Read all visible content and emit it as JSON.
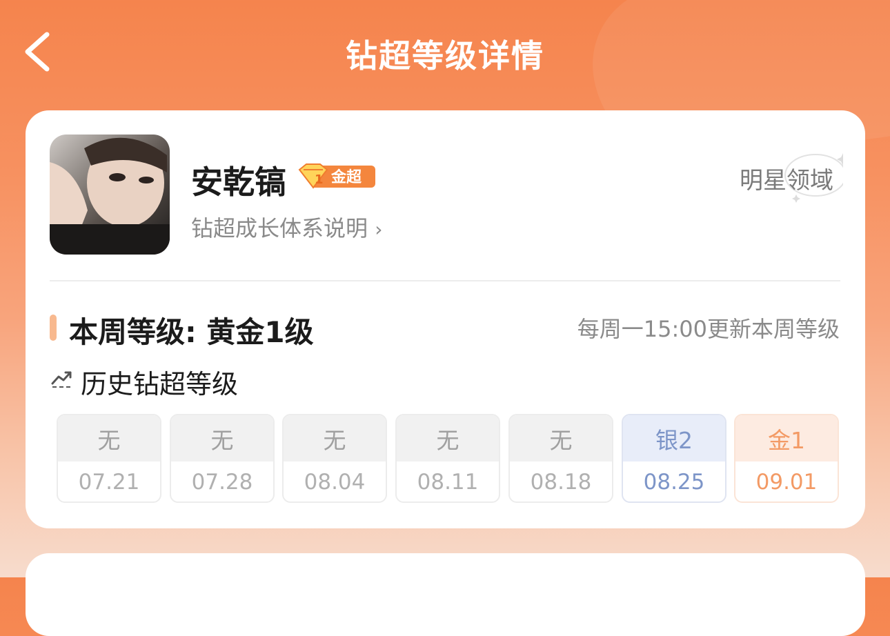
{
  "header": {
    "title": "钻超等级详情"
  },
  "profile": {
    "name": "安乾镐",
    "badge": {
      "level_number": "1",
      "label": "金超",
      "icon": "diamond-icon"
    },
    "growth_link": "钻超成长体系说明",
    "domain": "明星领域"
  },
  "level": {
    "title": "本周等级: 黄金1级",
    "update_note": "每周一15:00更新本周等级"
  },
  "history": {
    "title": "历史钻超等级",
    "weeks": [
      {
        "level": "无",
        "date": "07.21",
        "tier": "none"
      },
      {
        "level": "无",
        "date": "07.28",
        "tier": "none"
      },
      {
        "level": "无",
        "date": "08.04",
        "tier": "none"
      },
      {
        "level": "无",
        "date": "08.11",
        "tier": "none"
      },
      {
        "level": "无",
        "date": "08.18",
        "tier": "none"
      },
      {
        "level": "银2",
        "date": "08.25",
        "tier": "silver"
      },
      {
        "level": "金1",
        "date": "09.01",
        "tier": "gold"
      }
    ]
  },
  "colors": {
    "header_orange": "#f5844d",
    "gold_text": "#f39a65",
    "silver_text": "#7d95c8",
    "accent_bar": "#f8b98f"
  }
}
